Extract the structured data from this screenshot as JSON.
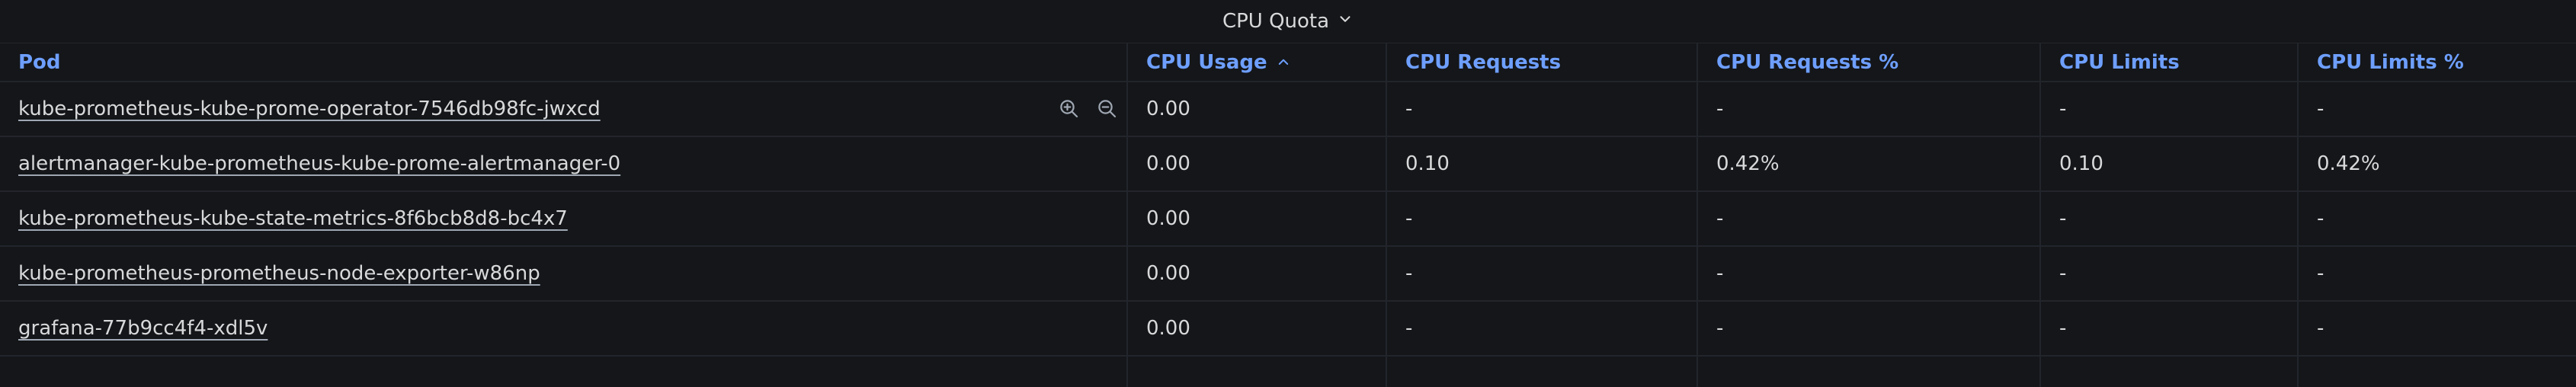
{
  "panel": {
    "title": "CPU Quota"
  },
  "table": {
    "columns": [
      "Pod",
      "CPU Usage",
      "CPU Requests",
      "CPU Requests %",
      "CPU Limits",
      "CPU Limits %"
    ],
    "sort_column": "CPU Usage",
    "sort_direction": "ascending",
    "rows": [
      [
        "kube-prometheus-kube-prome-operator-7546db98fc-jwxcd",
        "0.00",
        "-",
        "-",
        "-",
        "-"
      ],
      [
        "alertmanager-kube-prometheus-kube-prome-alertmanager-0",
        "0.00",
        "0.10",
        "0.42%",
        "0.10",
        "0.42%"
      ],
      [
        "kube-prometheus-kube-state-metrics-8f6bcb8d8-bc4x7",
        "0.00",
        "-",
        "-",
        "-",
        "-"
      ],
      [
        "kube-prometheus-prometheus-node-exporter-w86np",
        "0.00",
        "-",
        "-",
        "-",
        "-"
      ],
      [
        "grafana-77b9cc4f4-xdl5v",
        "0.00",
        "-",
        "-",
        "-",
        "-"
      ]
    ]
  },
  "colors": {
    "background": "#141619",
    "header_text": "#6e9fff",
    "body_text": "#d8d9da",
    "grid": "#22252b"
  },
  "icons": {
    "title_dropdown": "chevron-down-icon",
    "sort": "caret-up-icon",
    "row_action_1": "zoom-in-icon",
    "row_action_2": "zoom-out-icon"
  }
}
